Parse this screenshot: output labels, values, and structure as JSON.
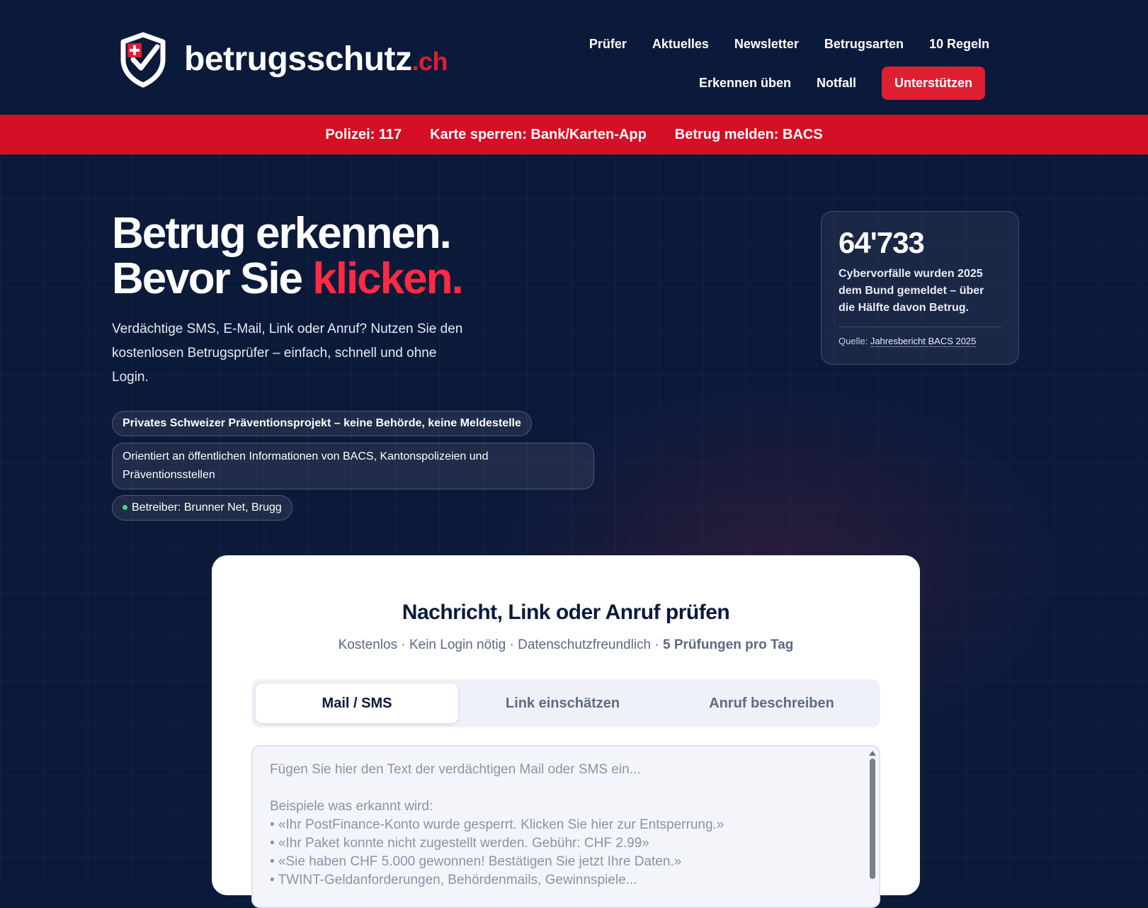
{
  "brand": {
    "name": "betrugsschutz",
    "tld": ".ch"
  },
  "nav": {
    "top": [
      "Prüfer",
      "Aktuelles",
      "Newsletter",
      "Betrugsarten",
      "10 Regeln"
    ],
    "bottom": [
      "Erkennen üben",
      "Notfall"
    ],
    "support_label": "Unterstützen"
  },
  "emergency": {
    "police": "Polizei: 117",
    "card": "Karte sperren: Bank/Karten-App",
    "report": "Betrug melden: BACS"
  },
  "hero": {
    "title_line1": "Betrug erkennen.",
    "title_line2_prefix": "Bevor Sie ",
    "title_line2_accent": "klicken.",
    "lead": "Verdächtige SMS, E-Mail, Link oder Anruf? Nutzen Sie den kostenlosen Betrugsprüfer – einfach, schnell und ohne Login.",
    "chips": [
      "Privates Schweizer Präventionsprojekt – keine Behörde, keine Meldestelle",
      "Orientiert an öffentlichen Informationen von BACS, Kantonspolizeien und Präventionsstellen",
      "Betreiber: Brunner Net, Brugg"
    ]
  },
  "stat": {
    "number": "64'733",
    "text": "Cybervorfälle wurden 2025 dem Bund gemeldet – über die Hälfte davon Betrug.",
    "source_label": "Quelle: ",
    "source_link": "Jahresbericht BACS 2025"
  },
  "checker": {
    "title": "Nachricht, Link oder Anruf prüfen",
    "subtitle": "Kostenlos · Kein Login nötig · Datenschutzfreundlich · ",
    "subtitle_limit": "5 Prüfungen pro Tag",
    "tabs": [
      "Mail / SMS",
      "Link einschätzen",
      "Anruf beschreiben"
    ],
    "textarea_value": "",
    "textarea_placeholder": "Fügen Sie hier den Text der verdächtigen Mail oder SMS ein...\n\nBeispiele was erkannt wird:\n• «Ihr PostFinance-Konto wurde gesperrt. Klicken Sie hier zur Entsperrung.»\n• «Ihr Paket konnte nicht zugestellt werden. Gebühr: CHF 2.99»\n• «Sie haben CHF 5.000 gewonnen! Bestätigen Sie jetzt Ihre Daten.»\n• TWINT-Geldanforderungen, Behördenmails, Gewinnspiele..."
  },
  "colors": {
    "background": "#0c1a3a",
    "accent": "#e01e32",
    "panel": "#ffffff"
  },
  "icons": {
    "logo": "shield-check-icon"
  }
}
